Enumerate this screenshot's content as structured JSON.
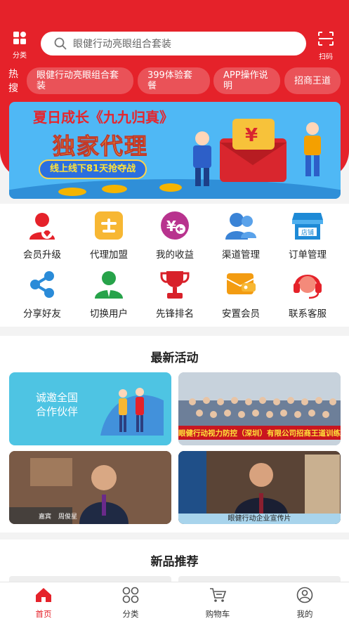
{
  "header": {
    "category_label": "分类",
    "scan_label": "扫码",
    "search_placeholder": "眼健行动亮眼组合套装",
    "hot_label": "热搜",
    "hot_tags": [
      "眼健行动亮眼组合套装",
      "399体验套餐",
      "APP操作说明",
      "招商王道"
    ]
  },
  "banner": {
    "line1": "夏日成长《九九归真》",
    "line2": "独家代理",
    "line3": "线上线下81天抢夺战"
  },
  "menu": [
    {
      "label": "会员升级",
      "icon": "member-upgrade-icon"
    },
    {
      "label": "代理加盟",
      "icon": "agent-join-icon"
    },
    {
      "label": "我的收益",
      "icon": "income-icon"
    },
    {
      "label": "渠道管理",
      "icon": "channel-icon"
    },
    {
      "label": "订单管理",
      "icon": "store-icon"
    },
    {
      "label": "分享好友",
      "icon": "share-icon"
    },
    {
      "label": "切换用户",
      "icon": "switch-user-icon"
    },
    {
      "label": "先锋排名",
      "icon": "trophy-icon"
    },
    {
      "label": "安置会员",
      "icon": "wallet-icon"
    },
    {
      "label": "联系客服",
      "icon": "headset-icon"
    }
  ],
  "store_sign": "店铺",
  "activities": {
    "title": "最新活动",
    "card1_title": "诚邀全国",
    "card1_sub": "合作伙伴",
    "card2_caption": "眼健行动视力防控（深圳）有限公司招商王道训练营圆满",
    "card4_caption": "眼健行动企业宣传片",
    "card3_name1": "嘉宾",
    "card3_name2": "周俊星"
  },
  "new_products": {
    "title": "新品推荐"
  },
  "nav": {
    "items": [
      {
        "label": "首页"
      },
      {
        "label": "分类"
      },
      {
        "label": "购物车"
      },
      {
        "label": "我的"
      }
    ]
  },
  "colors": {
    "primary": "#e5222a",
    "banner_bg": "#4fb8f5",
    "activity_teal": "#4ec4e3"
  }
}
